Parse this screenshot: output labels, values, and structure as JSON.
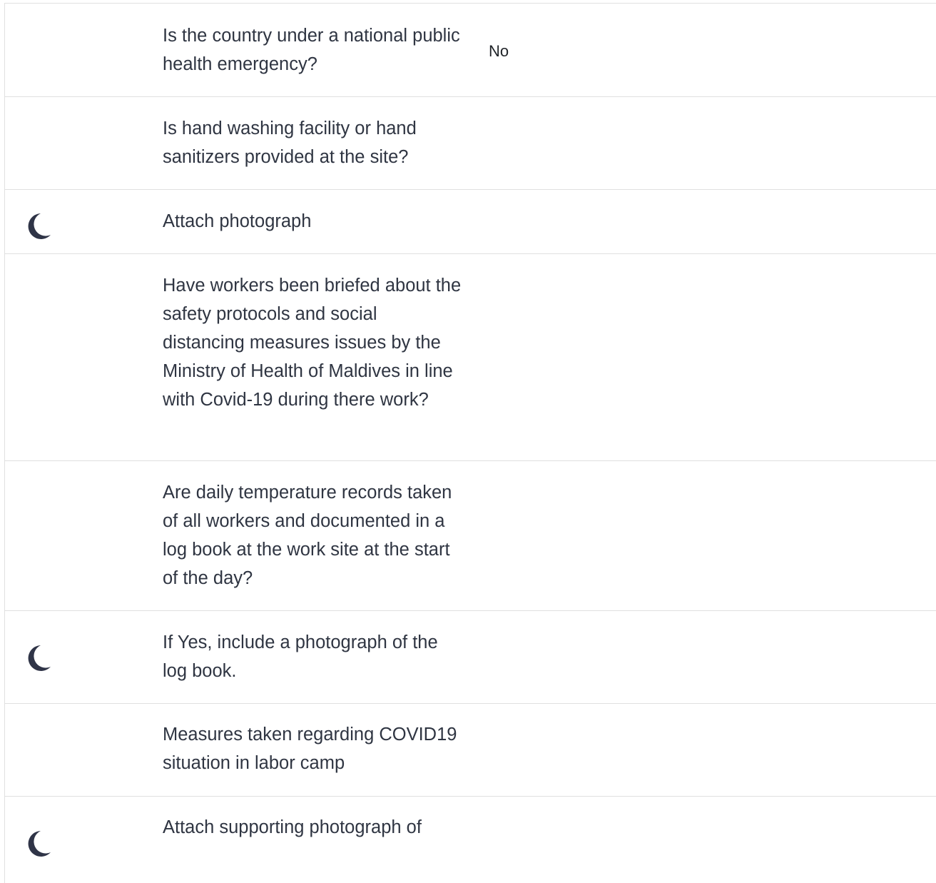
{
  "rows": [
    {
      "label": "Is the country under a national public health emergency?",
      "value": "No",
      "has_icon": false
    },
    {
      "label": "Is hand washing facility or hand sanitizers provided at the site?",
      "value": "",
      "has_icon": false
    },
    {
      "label": "Attach photograph",
      "value": "",
      "has_icon": true,
      "icon": "moon-icon"
    },
    {
      "label": "Have workers been briefed about the safety protocols and social distancing measures issues by the Ministry of Health of Maldives in line with Covid-19 during there work?",
      "value": "",
      "has_icon": false
    },
    {
      "label": "Are daily temperature records taken of all workers and documented in a log book at the work site at the start of the day?",
      "value": "",
      "has_icon": false
    },
    {
      "label": "If Yes, include a photograph of the log book.",
      "value": "",
      "has_icon": true,
      "icon": "moon-icon"
    },
    {
      "label": "Measures taken regarding COVID19 situation in labor camp",
      "value": "",
      "has_icon": false
    },
    {
      "label": "Attach supporting photograph of",
      "value": "",
      "has_icon": true,
      "icon": "moon-icon"
    }
  ],
  "colors": {
    "text": "#2f3542",
    "icon": "#2f3447",
    "border": "#e0e0e0"
  }
}
